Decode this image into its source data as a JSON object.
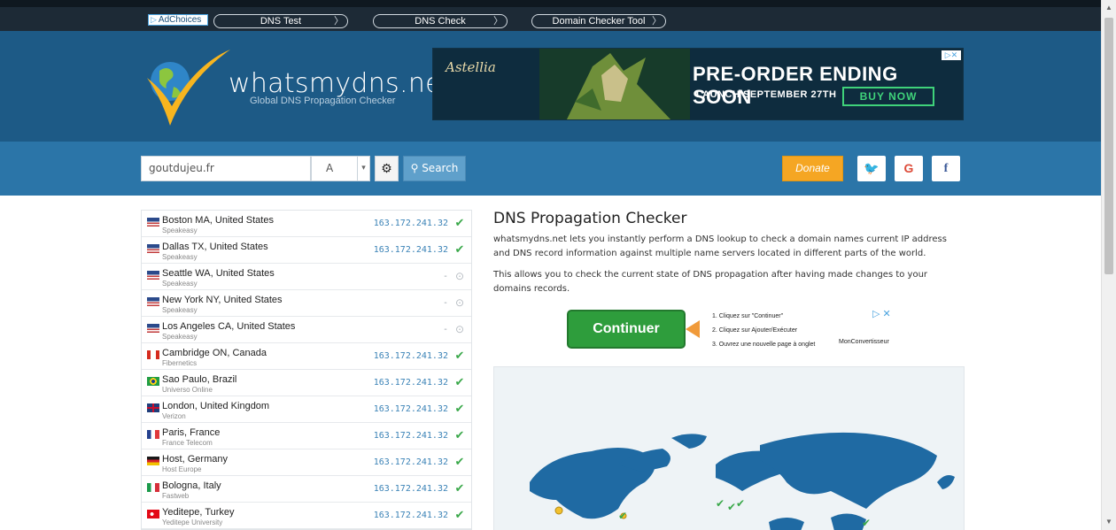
{
  "topbar": {
    "adchoices_label": "AdChoices",
    "links": [
      "DNS Test",
      "DNS Check",
      "Domain Checker Tool"
    ]
  },
  "header": {
    "site_name": "whatsmydns.net",
    "tagline": "Global DNS Propagation Checker"
  },
  "banner_ad": {
    "brand": "Astellia",
    "headline": "PRE-ORDER ENDING SOON",
    "subline": "LAUNCH SEPTEMBER 27TH",
    "cta": "BUY NOW"
  },
  "search": {
    "domain_value": "goutdujeu.fr",
    "record_type": "A",
    "search_label": "Search",
    "donate_label": "Donate",
    "social": [
      "twitter-icon",
      "google-icon",
      "facebook-icon"
    ]
  },
  "results": [
    {
      "location": "Boston MA, United States",
      "provider": "Speakeasy",
      "ip": "163.172.241.32",
      "status": "ok",
      "flag": "us"
    },
    {
      "location": "Dallas TX, United States",
      "provider": "Speakeasy",
      "ip": "163.172.241.32",
      "status": "ok",
      "flag": "us"
    },
    {
      "location": "Seattle WA, United States",
      "provider": "Speakeasy",
      "ip": "-",
      "status": "pending",
      "flag": "us"
    },
    {
      "location": "New York NY, United States",
      "provider": "Speakeasy",
      "ip": "-",
      "status": "pending",
      "flag": "us"
    },
    {
      "location": "Los Angeles CA, United States",
      "provider": "Speakeasy",
      "ip": "-",
      "status": "pending",
      "flag": "us"
    },
    {
      "location": "Cambridge ON, Canada",
      "provider": "Fibernetics",
      "ip": "163.172.241.32",
      "status": "ok",
      "flag": "ca"
    },
    {
      "location": "Sao Paulo, Brazil",
      "provider": "Universo Online",
      "ip": "163.172.241.32",
      "status": "ok",
      "flag": "br"
    },
    {
      "location": "London, United Kingdom",
      "provider": "Verizon",
      "ip": "163.172.241.32",
      "status": "ok",
      "flag": "uk"
    },
    {
      "location": "Paris, France",
      "provider": "France Telecom",
      "ip": "163.172.241.32",
      "status": "ok",
      "flag": "fr"
    },
    {
      "location": "Host, Germany",
      "provider": "Host Europe",
      "ip": "163.172.241.32",
      "status": "ok",
      "flag": "de"
    },
    {
      "location": "Bologna, Italy",
      "provider": "Fastweb",
      "ip": "163.172.241.32",
      "status": "ok",
      "flag": "it"
    },
    {
      "location": "Yeditepe, Turkey",
      "provider": "Yeditepe University",
      "ip": "163.172.241.32",
      "status": "ok",
      "flag": "tr"
    }
  ],
  "content": {
    "title": "DNS Propagation Checker",
    "para1": "whatsmydns.net lets you instantly perform a DNS lookup to check a domain names current IP address and DNS record information against multiple name servers located in different parts of the world.",
    "para2": "This allows you to check the current state of DNS propagation after having made changes to your domains records."
  },
  "inline_ad": {
    "button": "Continuer",
    "steps": [
      "1. Cliquez sur \"Continuer\"",
      "2. Cliquez sur Ajouter/Exécuter",
      "3. Ouvrez une nouvelle page à onglet"
    ],
    "brand": "MonConvertisseur"
  },
  "colors": {
    "header_bg": "#1d5a86",
    "search_band": "#2b75a8",
    "ip_text": "#3a82b6",
    "ok_green": "#3aa84a",
    "donate": "#f5a623"
  }
}
